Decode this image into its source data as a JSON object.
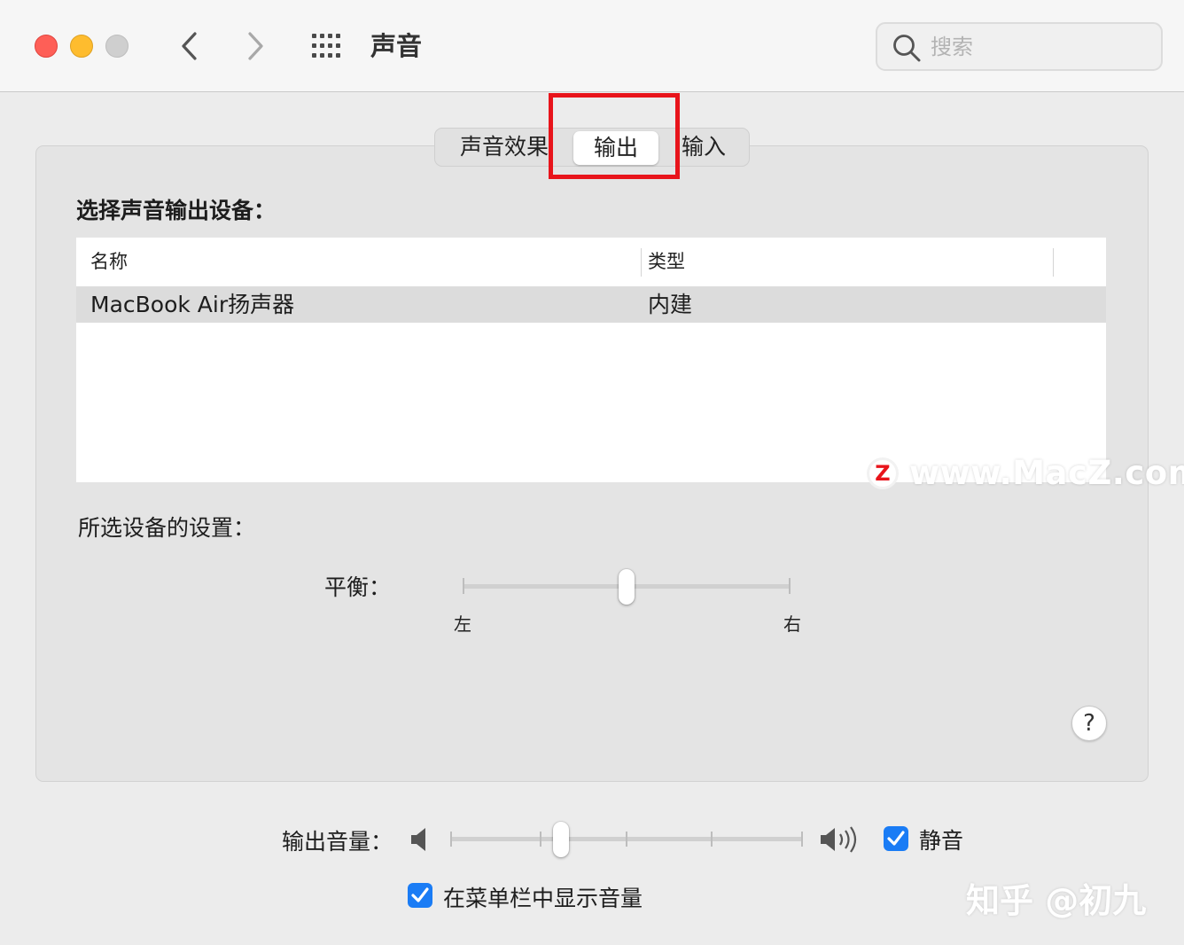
{
  "window": {
    "title": "声音",
    "controls": [
      "close",
      "minimize",
      "zoom"
    ],
    "colors": {
      "close": "#fe5f57",
      "minimize": "#febc2e",
      "zoom": "#cfcfcf"
    }
  },
  "toolbar": {
    "back_icon": "chevron-left-icon",
    "forward_icon": "chevron-right-icon",
    "show_all_icon": "grid-icon",
    "search": {
      "placeholder": "搜索",
      "value": ""
    }
  },
  "tabs": [
    {
      "label": "声音效果",
      "selected": false
    },
    {
      "label": "输出",
      "selected": true
    },
    {
      "label": "输入",
      "selected": false
    }
  ],
  "output": {
    "choose_label": "选择声音输出设备：",
    "table": {
      "columns": [
        "名称",
        "类型"
      ],
      "rows": [
        {
          "name": "MacBook Air扬声器",
          "type": "内建",
          "selected": true
        }
      ]
    },
    "settings_label": "所选设备的设置：",
    "balance": {
      "label": "平衡：",
      "left": "左",
      "right": "右",
      "value": 0.5
    }
  },
  "help_label": "?",
  "volume": {
    "label": "输出音量：",
    "value": 0.3,
    "mute_label": "静音",
    "mute_checked": true,
    "menubar_label": "在菜单栏中显示音量",
    "menubar_checked": true,
    "accent_color": "#1a7cf5"
  },
  "watermarks": {
    "site_logo": "Z",
    "site": "www.MacZ.com",
    "author": "知乎 @初九"
  },
  "annotation_color": "#e8141b"
}
